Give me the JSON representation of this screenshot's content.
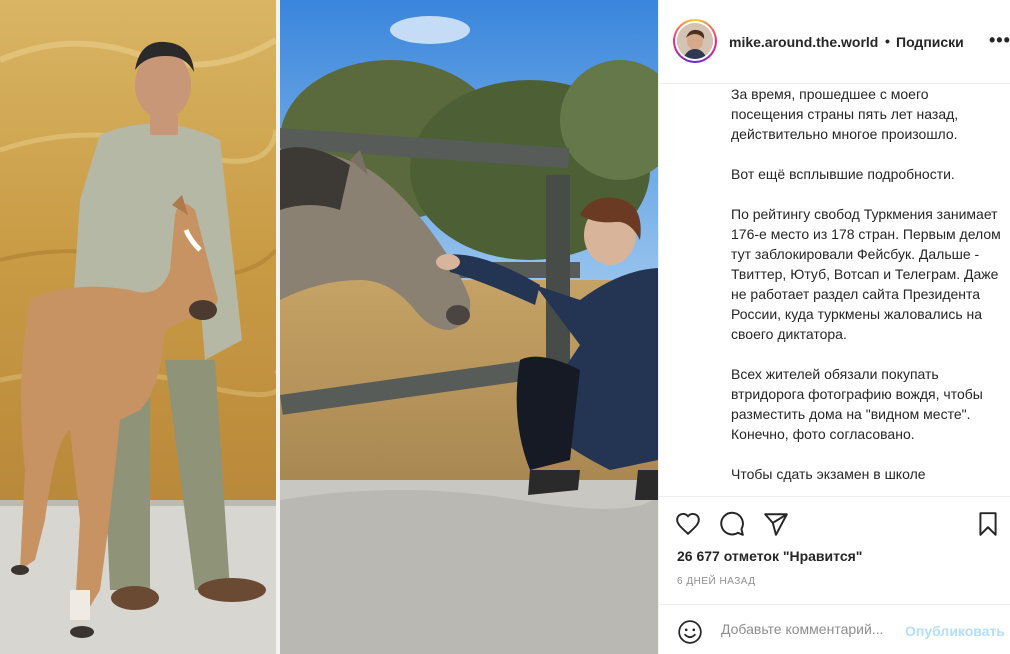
{
  "post": {
    "username": "mike.around.the.world",
    "separator": "•",
    "follow_label": "Подписки",
    "more_label": "•••",
    "caption_paragraphs": [
      "За время, прошедшее с моего посещения страны пять лет назад, действительно многое произошло.",
      "Вот ещё всплывшие подробности.",
      "По рейтингу свобод Туркмения занимает 176-е место из 178 стран. Первым делом тут заблокировали Фейсбук. Дальше - Твиттер, Ютуб, Вотсап и Телеграм. Даже не работает раздел сайта Президента России, куда туркмены жаловались на своего диктатора.",
      "Всех жителей обязали покупать втридорога фотографию вождя, чтобы разместить дома на \"видном месте\". Конечно, фото согласовано.",
      "Чтобы сдать экзамен в школе"
    ],
    "likes_text": "26 677 отметок \"Нравится\"",
    "date_text": "6 дней назад",
    "comment_placeholder": "Добавьте комментарий...",
    "publish_label": "Опубликовать"
  },
  "icons": {
    "like": "heart-icon",
    "comment": "comment-icon",
    "share": "share-icon",
    "save": "bookmark-icon",
    "emoji": "emoji-icon",
    "more": "more-options-icon"
  },
  "colors": {
    "text": "#262626",
    "muted": "#8e8e8e",
    "publish_disabled": "#b2dffc",
    "divider": "#efefef"
  }
}
